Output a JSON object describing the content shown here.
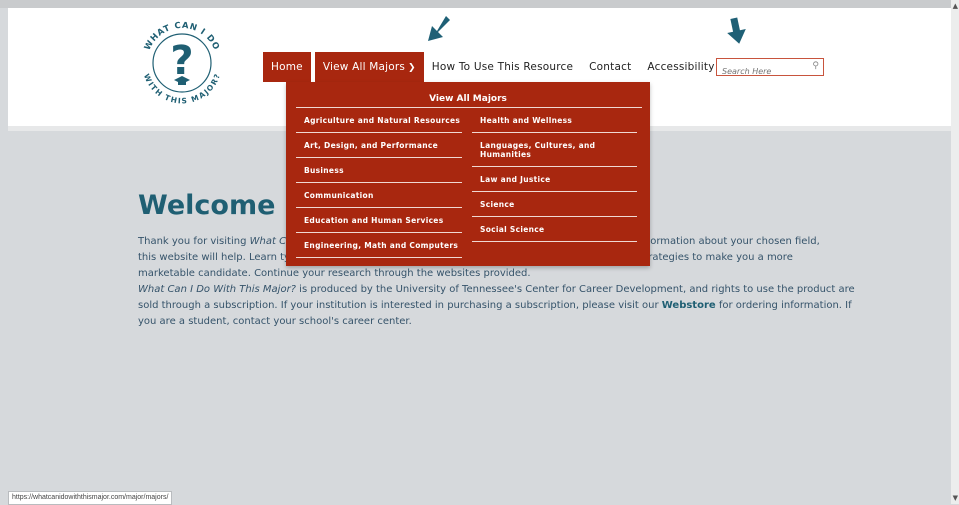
{
  "logo": {
    "top_text": "WHAT CAN I DO",
    "bottom_text": "WITH THIS MAJOR?",
    "symbol": "?"
  },
  "nav": {
    "items": [
      {
        "label": "Home"
      },
      {
        "label": "View All Majors"
      },
      {
        "label": "How To Use This Resource"
      },
      {
        "label": "Contact"
      },
      {
        "label": "Accessibility"
      }
    ]
  },
  "search": {
    "placeholder": "Search Here"
  },
  "dropdown": {
    "title": "View All Majors",
    "left": [
      "Agriculture and Natural Resources",
      "Art, Design, and Performance",
      "Business",
      "Communication",
      "Education and Human Services",
      "Engineering, Math and Computers"
    ],
    "right": [
      "Health and Wellness",
      "Languages, Cultures, and Humanities",
      "Law and Justice",
      "Science",
      "Social Science"
    ]
  },
  "welcome": {
    "heading": "Welcome",
    "line1a": "Thank you for visiting ",
    "line1b": "What Ca",
    "line1c": "ormation about your chosen field,",
    "line2a": "this website will help. Learn typ",
    "line2b": "trategies to make you a more",
    "line3": "marketable candidate. Continue your research through the websites provided.",
    "line4a": "What Can I Do With This Major?",
    "line4b": " is produced by the University of Tennessee's Center for Career Development, and rights to use the product are",
    "line5a": "sold through a subscription. If your institution is interested in purchasing a subscription, please visit our ",
    "line5b": "Webstore",
    "line5c": " for ordering information. If",
    "line6": "you are a student, contact your school's career center."
  },
  "status_bar": {
    "url": "https://whatcanidowiththismajor.com/major/majors/"
  },
  "colors": {
    "accent": "#a8270f",
    "heading": "#1f5f73",
    "body_text": "#35536a",
    "arrow": "#1f6076",
    "background": "#d6d9dc"
  },
  "icons": {
    "search": "search-icon",
    "chevron": "chevron-down-icon",
    "arrows": "down-left-arrow-icon"
  }
}
